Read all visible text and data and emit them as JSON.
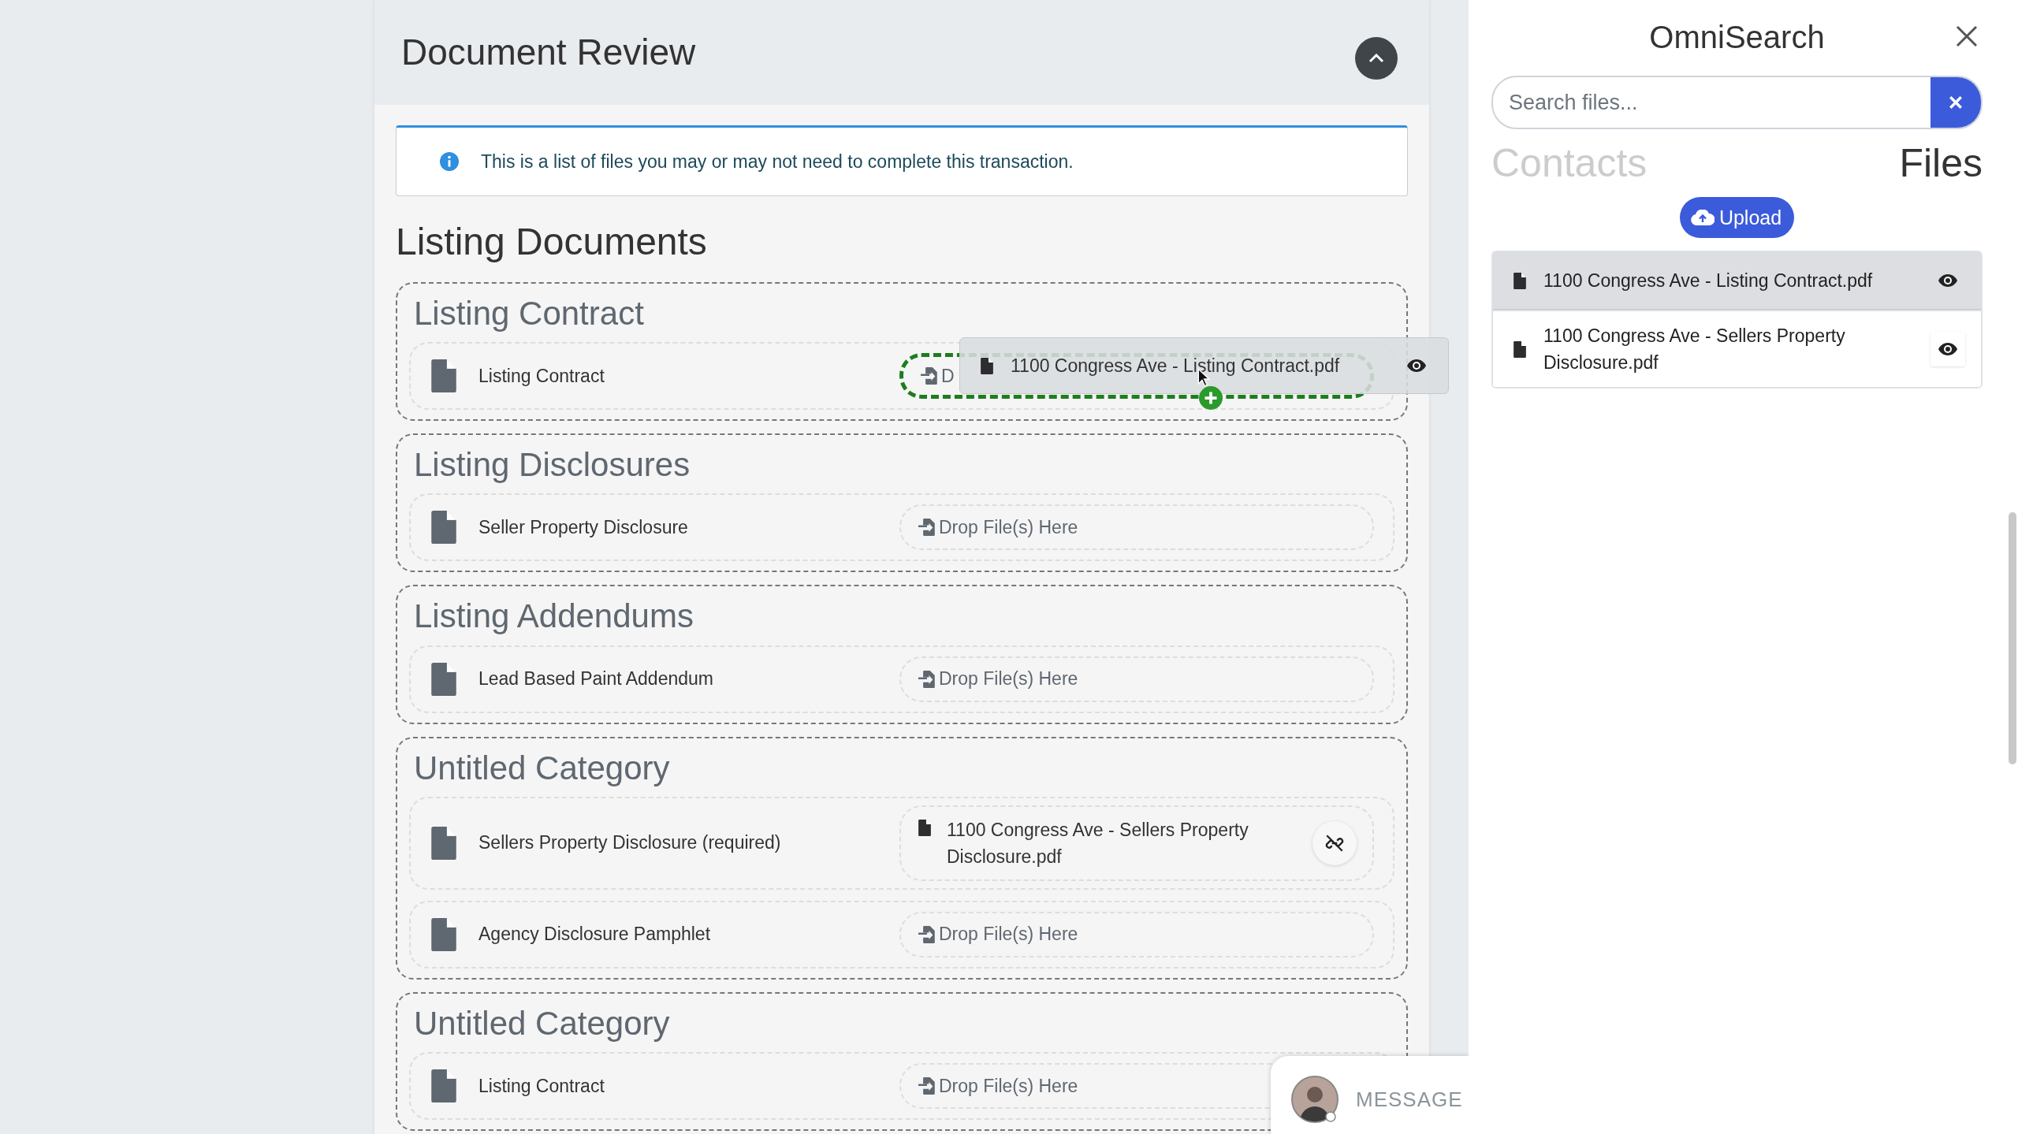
{
  "review": {
    "title": "Document Review",
    "notice": "This is a list of files you may or may not need to complete this transaction.",
    "section_title": "Listing Documents",
    "categories": [
      {
        "title": "Listing Contract",
        "rows": [
          {
            "name": "Listing Contract",
            "kind": "drop",
            "drop_label": "D",
            "drag_target": true
          }
        ]
      },
      {
        "title": "Listing Disclosures",
        "rows": [
          {
            "name": "Seller Property Disclosure",
            "kind": "drop",
            "drop_label": "Drop File(s) Here",
            "drag_target": false
          }
        ]
      },
      {
        "title": "Listing Addendums",
        "rows": [
          {
            "name": "Lead Based Paint Addendum",
            "kind": "drop",
            "drop_label": "Drop File(s) Here",
            "drag_target": false
          }
        ]
      },
      {
        "title": "Untitled Category",
        "rows": [
          {
            "name": "Sellers Property Disclosure (required)",
            "kind": "attached",
            "file": "1100 Congress Ave - Sellers Property Disclosure.pdf"
          },
          {
            "name": "Agency Disclosure Pamphlet",
            "kind": "drop",
            "drop_label": "Drop File(s) Here",
            "drag_target": false
          }
        ]
      },
      {
        "title": "Untitled Category",
        "rows": [
          {
            "name": "Listing Contract",
            "kind": "drop",
            "drop_label": "Drop File(s) Here",
            "drag_target": false
          }
        ]
      }
    ]
  },
  "dragged_file": {
    "name": "1100 Congress Ave - Listing Contract.pdf"
  },
  "omnisearch": {
    "title": "OmniSearch",
    "search": {
      "placeholder": "Search files..."
    },
    "tabs": [
      {
        "label": "Contacts",
        "selected": false
      },
      {
        "label": "Files",
        "selected": true
      }
    ],
    "upload_label": "Upload",
    "files": [
      {
        "name": "1100 Congress Ave - Listing Contract.pdf",
        "selected": true
      },
      {
        "name": "1100 Congress Ave - Sellers Property Disclosure.pdf",
        "selected": false
      }
    ]
  },
  "message_widget": {
    "label": "MESSAGE"
  }
}
